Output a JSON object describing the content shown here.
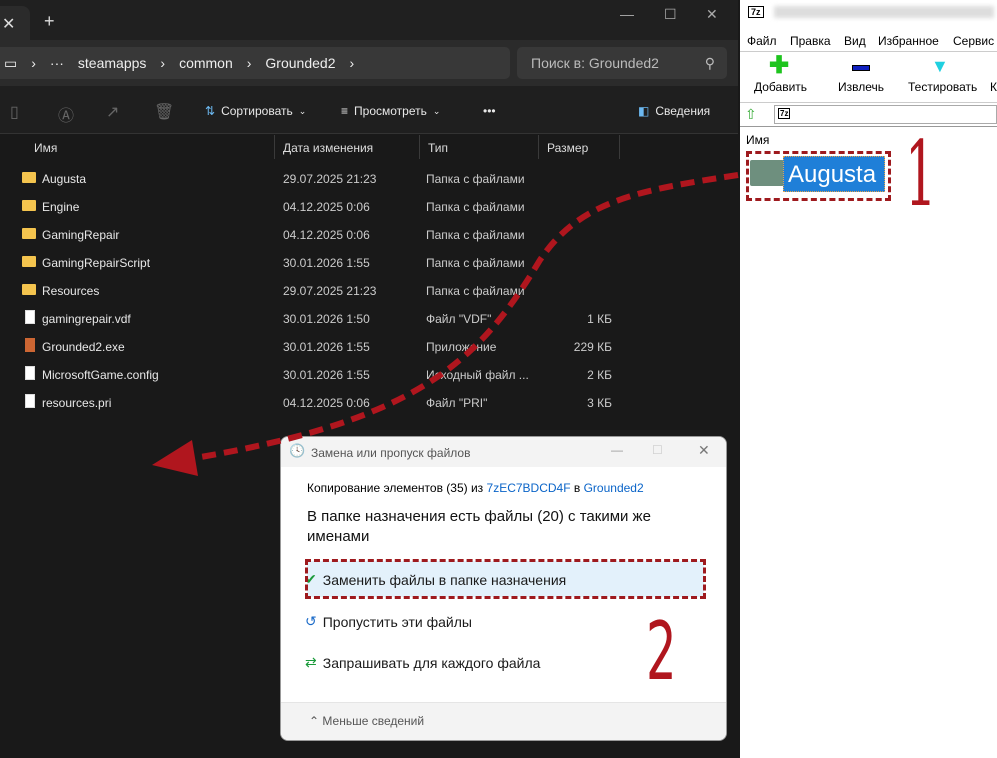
{
  "explorer": {
    "breadcrumb": [
      "steamapps",
      "common",
      "Grounded2"
    ],
    "search_placeholder": "Поиск в: Grounded2",
    "toolbar": {
      "sort": "Сортировать",
      "view": "Просмотреть",
      "more": "•••",
      "details": "Сведения"
    },
    "columns": [
      "Имя",
      "Дата изменения",
      "Тип",
      "Размер"
    ],
    "files": [
      {
        "name": "Augusta",
        "date": "29.07.2025 21:23",
        "type": "Папка с файлами",
        "size": "",
        "kind": "folder"
      },
      {
        "name": "Engine",
        "date": "04.12.2025 0:06",
        "type": "Папка с файлами",
        "size": "",
        "kind": "folder"
      },
      {
        "name": "GamingRepair",
        "date": "04.12.2025 0:06",
        "type": "Папка с файлами",
        "size": "",
        "kind": "folder"
      },
      {
        "name": "GamingRepairScript",
        "date": "30.01.2026 1:55",
        "type": "Папка с файлами",
        "size": "",
        "kind": "folder"
      },
      {
        "name": "Resources",
        "date": "29.07.2025 21:23",
        "type": "Папка с файлами",
        "size": "",
        "kind": "folder"
      },
      {
        "name": "gamingrepair.vdf",
        "date": "30.01.2026 1:50",
        "type": "Файл \"VDF\"",
        "size": "1 КБ",
        "kind": "file"
      },
      {
        "name": "Grounded2.exe",
        "date": "30.01.2026 1:55",
        "type": "Приложение",
        "size": "229 КБ",
        "kind": "exe"
      },
      {
        "name": "MicrosoftGame.config",
        "date": "30.01.2026 1:55",
        "type": "Исходный файл ...",
        "size": "2 КБ",
        "kind": "file"
      },
      {
        "name": "resources.pri",
        "date": "04.12.2025 0:06",
        "type": "Файл \"PRI\"",
        "size": "3 КБ",
        "kind": "file"
      }
    ]
  },
  "sevenzip": {
    "logo": "7z",
    "menu": [
      "Файл",
      "Правка",
      "Вид",
      "Избранное",
      "Сервис"
    ],
    "tools": [
      "Добавить",
      "Извлечь",
      "Тестировать",
      "К"
    ],
    "column": "Имя",
    "item": "Augusta"
  },
  "dialog": {
    "title": "Замена или пропуск файлов",
    "copy_prefix": "Копирование элементов (35) из ",
    "source": "7zEC7BDCD4F",
    "copy_mid": " в ",
    "dest": "Grounded2",
    "heading": "В папке назначения есть файлы (20) с такими же именами",
    "options": [
      "Заменить файлы в папке назначения",
      "Пропустить эти файлы",
      "Запрашивать для каждого файла"
    ],
    "less": "Меньше сведений"
  },
  "annotations": {
    "step1": "1",
    "step2": "2",
    "color": "#b0161e"
  }
}
